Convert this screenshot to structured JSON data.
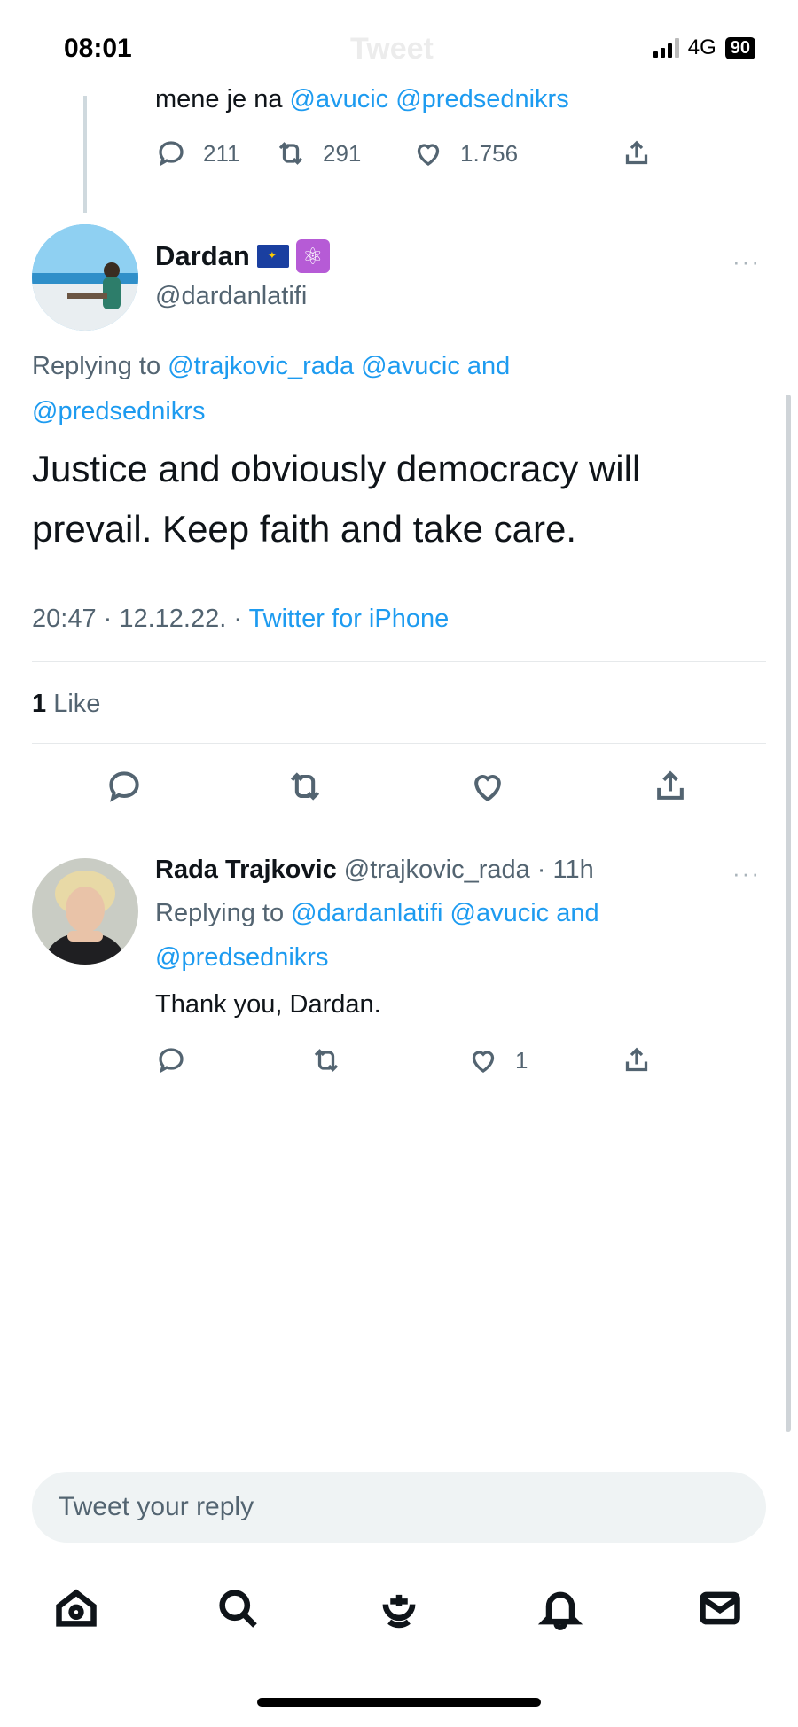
{
  "status_bar": {
    "time": "08:01",
    "ghost_title": "Tweet",
    "network": "4G",
    "battery": "90"
  },
  "parent_tweet": {
    "text_prefix": "mene je na ",
    "mentions": "@avucic @predsednikrs",
    "actions": {
      "replies": "211",
      "retweets": "291",
      "likes": "1.756"
    }
  },
  "main_tweet": {
    "name": "Dardan",
    "badges": [
      "eu-flag-icon",
      "atom-icon"
    ],
    "handle": "@dardanlatifi",
    "more": "···",
    "replying_prefix": "Replying to ",
    "replying_mentions_1": "@trajkovic_rada @avucic",
    "replying_and": " and ",
    "replying_mentions_2": "@predsednikrs",
    "body": "Justice and obviously democracy will prevail. Keep faith and take care.",
    "time": "20:47",
    "date": "12.12.22.",
    "sep": " · ",
    "source": "Twitter for iPhone",
    "like_count": "1",
    "like_label": " Like"
  },
  "reply_tweet": {
    "name": "Rada Trajkovic",
    "handle": "@trajkovic_rada",
    "age": "11h",
    "more": "···",
    "replying_prefix": "Replying to ",
    "replying_mentions_1": "@dardanlatifi @avucic",
    "replying_and": " and",
    "replying_mentions_2": "@predsednikrs",
    "text": "Thank you, Dardan.",
    "likes": "1"
  },
  "composer": {
    "placeholder": "Tweet your reply"
  },
  "tabbar": {
    "tabs": [
      "home-icon",
      "search-icon",
      "spaces-icon",
      "notifications-icon",
      "messages-icon"
    ]
  },
  "colors": {
    "accent": "#1d9bf0",
    "secondary_text": "#536471",
    "primary_text": "#0f1419"
  }
}
